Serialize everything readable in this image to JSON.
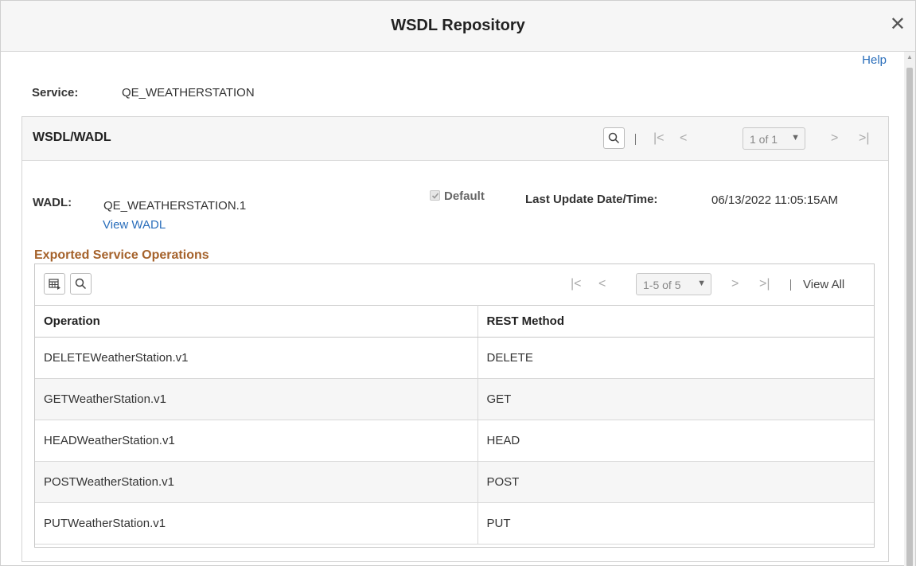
{
  "dialog": {
    "title": "WSDL Repository",
    "close_icon": "close-icon",
    "help_label": "Help"
  },
  "service": {
    "label": "Service:",
    "value": "QE_WEATHERSTATION"
  },
  "wsdl_panel": {
    "title": "WSDL/WADL",
    "pager": "1 of 1",
    "wadl_label": "WADL:",
    "wadl_value": "QE_WEATHERSTATION.1",
    "view_wadl": "View WADL",
    "default_label": "Default",
    "default_checked": true,
    "last_update_label": "Last Update Date/Time:",
    "last_update_value": "06/13/2022 11:05:15AM"
  },
  "operations": {
    "title": "Exported Service Operations",
    "pager": "1-5 of 5",
    "view_all": "View All",
    "columns": [
      "Operation",
      "REST Method"
    ],
    "rows": [
      {
        "operation": "DELETEWeatherStation.v1",
        "method": "DELETE"
      },
      {
        "operation": "GETWeatherStation.v1",
        "method": "GET"
      },
      {
        "operation": "HEADWeatherStation.v1",
        "method": "HEAD"
      },
      {
        "operation": "POSTWeatherStation.v1",
        "method": "POST"
      },
      {
        "operation": "PUTWeatherStation.v1",
        "method": "PUT"
      }
    ]
  },
  "colors": {
    "link": "#2a6ebb",
    "section_title": "#a5622b"
  }
}
